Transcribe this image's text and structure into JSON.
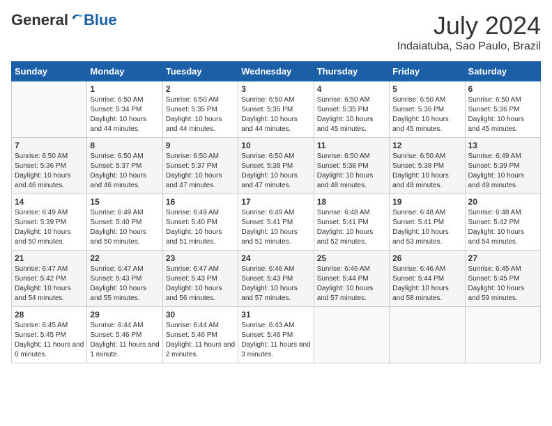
{
  "header": {
    "logo_general": "General",
    "logo_blue": "Blue",
    "month_year": "July 2024",
    "location": "Indaiatuba, Sao Paulo, Brazil"
  },
  "days_of_week": [
    "Sunday",
    "Monday",
    "Tuesday",
    "Wednesday",
    "Thursday",
    "Friday",
    "Saturday"
  ],
  "weeks": [
    [
      {
        "day": "",
        "sunrise": "",
        "sunset": "",
        "daylight": ""
      },
      {
        "day": "1",
        "sunrise": "Sunrise: 6:50 AM",
        "sunset": "Sunset: 5:34 PM",
        "daylight": "Daylight: 10 hours and 44 minutes."
      },
      {
        "day": "2",
        "sunrise": "Sunrise: 6:50 AM",
        "sunset": "Sunset: 5:35 PM",
        "daylight": "Daylight: 10 hours and 44 minutes."
      },
      {
        "day": "3",
        "sunrise": "Sunrise: 6:50 AM",
        "sunset": "Sunset: 5:35 PM",
        "daylight": "Daylight: 10 hours and 44 minutes."
      },
      {
        "day": "4",
        "sunrise": "Sunrise: 6:50 AM",
        "sunset": "Sunset: 5:35 PM",
        "daylight": "Daylight: 10 hours and 45 minutes."
      },
      {
        "day": "5",
        "sunrise": "Sunrise: 6:50 AM",
        "sunset": "Sunset: 5:36 PM",
        "daylight": "Daylight: 10 hours and 45 minutes."
      },
      {
        "day": "6",
        "sunrise": "Sunrise: 6:50 AM",
        "sunset": "Sunset: 5:36 PM",
        "daylight": "Daylight: 10 hours and 45 minutes."
      }
    ],
    [
      {
        "day": "7",
        "sunrise": "Sunrise: 6:50 AM",
        "sunset": "Sunset: 5:36 PM",
        "daylight": "Daylight: 10 hours and 46 minutes."
      },
      {
        "day": "8",
        "sunrise": "Sunrise: 6:50 AM",
        "sunset": "Sunset: 5:37 PM",
        "daylight": "Daylight: 10 hours and 46 minutes."
      },
      {
        "day": "9",
        "sunrise": "Sunrise: 6:50 AM",
        "sunset": "Sunset: 5:37 PM",
        "daylight": "Daylight: 10 hours and 47 minutes."
      },
      {
        "day": "10",
        "sunrise": "Sunrise: 6:50 AM",
        "sunset": "Sunset: 5:38 PM",
        "daylight": "Daylight: 10 hours and 47 minutes."
      },
      {
        "day": "11",
        "sunrise": "Sunrise: 6:50 AM",
        "sunset": "Sunset: 5:38 PM",
        "daylight": "Daylight: 10 hours and 48 minutes."
      },
      {
        "day": "12",
        "sunrise": "Sunrise: 6:50 AM",
        "sunset": "Sunset: 5:38 PM",
        "daylight": "Daylight: 10 hours and 48 minutes."
      },
      {
        "day": "13",
        "sunrise": "Sunrise: 6:49 AM",
        "sunset": "Sunset: 5:39 PM",
        "daylight": "Daylight: 10 hours and 49 minutes."
      }
    ],
    [
      {
        "day": "14",
        "sunrise": "Sunrise: 6:49 AM",
        "sunset": "Sunset: 5:39 PM",
        "daylight": "Daylight: 10 hours and 50 minutes."
      },
      {
        "day": "15",
        "sunrise": "Sunrise: 6:49 AM",
        "sunset": "Sunset: 5:40 PM",
        "daylight": "Daylight: 10 hours and 50 minutes."
      },
      {
        "day": "16",
        "sunrise": "Sunrise: 6:49 AM",
        "sunset": "Sunset: 5:40 PM",
        "daylight": "Daylight: 10 hours and 51 minutes."
      },
      {
        "day": "17",
        "sunrise": "Sunrise: 6:49 AM",
        "sunset": "Sunset: 5:41 PM",
        "daylight": "Daylight: 10 hours and 51 minutes."
      },
      {
        "day": "18",
        "sunrise": "Sunrise: 6:48 AM",
        "sunset": "Sunset: 5:41 PM",
        "daylight": "Daylight: 10 hours and 52 minutes."
      },
      {
        "day": "19",
        "sunrise": "Sunrise: 6:48 AM",
        "sunset": "Sunset: 5:41 PM",
        "daylight": "Daylight: 10 hours and 53 minutes."
      },
      {
        "day": "20",
        "sunrise": "Sunrise: 6:48 AM",
        "sunset": "Sunset: 5:42 PM",
        "daylight": "Daylight: 10 hours and 54 minutes."
      }
    ],
    [
      {
        "day": "21",
        "sunrise": "Sunrise: 6:47 AM",
        "sunset": "Sunset: 5:42 PM",
        "daylight": "Daylight: 10 hours and 54 minutes."
      },
      {
        "day": "22",
        "sunrise": "Sunrise: 6:47 AM",
        "sunset": "Sunset: 5:43 PM",
        "daylight": "Daylight: 10 hours and 55 minutes."
      },
      {
        "day": "23",
        "sunrise": "Sunrise: 6:47 AM",
        "sunset": "Sunset: 5:43 PM",
        "daylight": "Daylight: 10 hours and 56 minutes."
      },
      {
        "day": "24",
        "sunrise": "Sunrise: 6:46 AM",
        "sunset": "Sunset: 5:43 PM",
        "daylight": "Daylight: 10 hours and 57 minutes."
      },
      {
        "day": "25",
        "sunrise": "Sunrise: 6:46 AM",
        "sunset": "Sunset: 5:44 PM",
        "daylight": "Daylight: 10 hours and 57 minutes."
      },
      {
        "day": "26",
        "sunrise": "Sunrise: 6:46 AM",
        "sunset": "Sunset: 5:44 PM",
        "daylight": "Daylight: 10 hours and 58 minutes."
      },
      {
        "day": "27",
        "sunrise": "Sunrise: 6:45 AM",
        "sunset": "Sunset: 5:45 PM",
        "daylight": "Daylight: 10 hours and 59 minutes."
      }
    ],
    [
      {
        "day": "28",
        "sunrise": "Sunrise: 6:45 AM",
        "sunset": "Sunset: 5:45 PM",
        "daylight": "Daylight: 11 hours and 0 minutes."
      },
      {
        "day": "29",
        "sunrise": "Sunrise: 6:44 AM",
        "sunset": "Sunset: 5:46 PM",
        "daylight": "Daylight: 11 hours and 1 minute."
      },
      {
        "day": "30",
        "sunrise": "Sunrise: 6:44 AM",
        "sunset": "Sunset: 5:46 PM",
        "daylight": "Daylight: 11 hours and 2 minutes."
      },
      {
        "day": "31",
        "sunrise": "Sunrise: 6:43 AM",
        "sunset": "Sunset: 5:46 PM",
        "daylight": "Daylight: 11 hours and 3 minutes."
      },
      {
        "day": "",
        "sunrise": "",
        "sunset": "",
        "daylight": ""
      },
      {
        "day": "",
        "sunrise": "",
        "sunset": "",
        "daylight": ""
      },
      {
        "day": "",
        "sunrise": "",
        "sunset": "",
        "daylight": ""
      }
    ]
  ]
}
